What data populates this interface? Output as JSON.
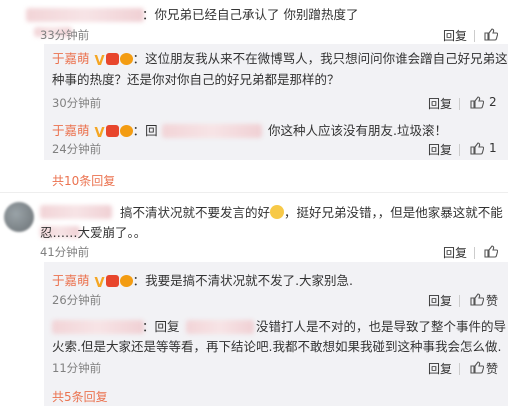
{
  "c0": {
    "text": "：你兄弟已经自己承认了 你别蹭热度了",
    "time": "33分钟前",
    "reply": "回复",
    "likes": ""
  },
  "c0_reply1": {
    "name": "于嘉萌",
    "text_l1": "：这位朋友我从来不在微博骂人，我只想问问你谁会蹭自己好兄弟这",
    "text_l2": "种事的热度？还是你对你自己的好兄弟都是那样的？",
    "time": "30分钟前",
    "reply": "回复",
    "likes": "2"
  },
  "c0_reply2": {
    "name": "于嘉萌",
    "prefix": "：回",
    "text": "你这种人应该没有朋友.垃圾滚！",
    "time": "24分钟前",
    "reply": "回复",
    "likes": "1"
  },
  "c0_more": "共10条回复",
  "c1": {
    "text_l1": "搞不清状况就不要发言的好",
    "text_l1b": "，挺好兄弟没错，，但是他家暴这就不能",
    "text_l2": "忍……大爱崩了。。",
    "time": "41分钟前",
    "reply": "回复",
    "likes": ""
  },
  "c1_reply1": {
    "name": "于嘉萌",
    "text": "：我要是搞不清状况就不发了.大家别急.",
    "time": "26分钟前",
    "reply": "回复",
    "likes": "赞"
  },
  "c1_reply2": {
    "prefix": "：回复",
    "text_l1": "没错打人是不对的，也是导致了整个事件的导",
    "text_l2": "火索.但是大家还是等等看，再下结论吧.我都不敢想如果我碰到这种事我会怎么做.",
    "time": "11分钟前",
    "reply": "回复",
    "likes": "赞"
  },
  "c1_more": "共5条回复",
  "icons": {
    "like": "thumbs-up-icon",
    "verified": "verified-v-icon",
    "emoji": "grin-emoji-icon"
  },
  "colors": {
    "accent": "#eb7350",
    "subbox": "#f2f2f5",
    "text": "#333333",
    "time": "#808080"
  }
}
